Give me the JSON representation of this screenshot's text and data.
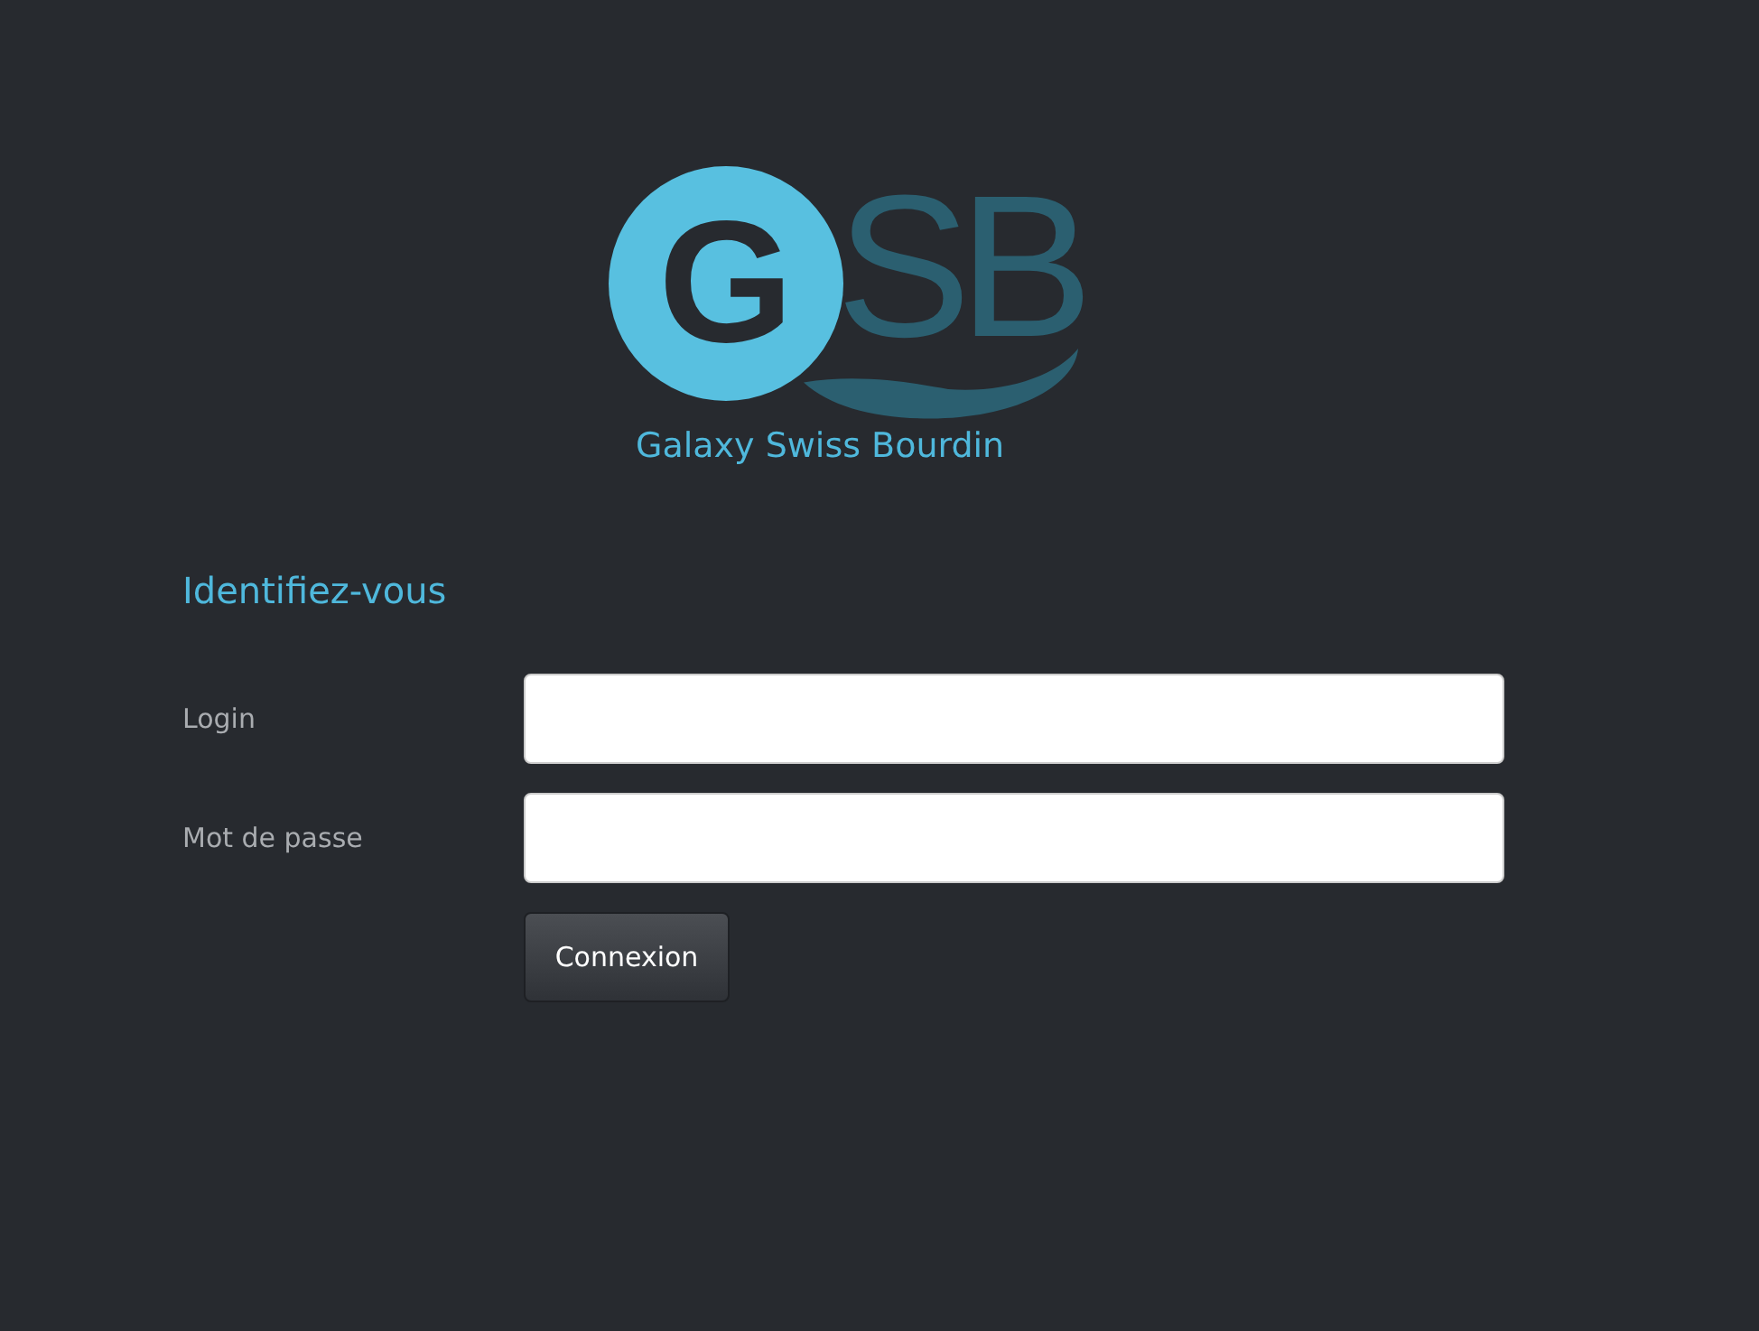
{
  "logo": {
    "circle_letter": "G",
    "letters": "SB",
    "tagline": "Galaxy Swiss Bourdin"
  },
  "form": {
    "heading": "Identifiez-vous",
    "fields": [
      {
        "label": "Login"
      },
      {
        "label": "Mot de passe"
      }
    ],
    "submit": "Connexion"
  }
}
